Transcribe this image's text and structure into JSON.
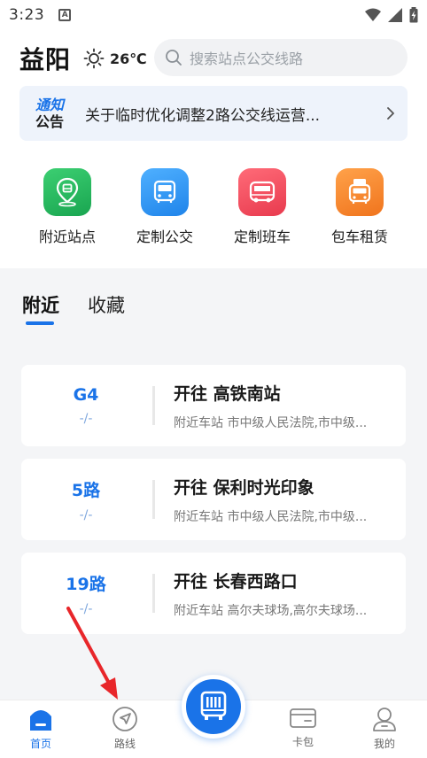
{
  "status_bar": {
    "time": "3:23",
    "notification_letter": "A"
  },
  "header": {
    "city": "益阳",
    "temperature": "26℃",
    "weather_icon": "sun-icon",
    "search_placeholder": "搜索站点公交线路"
  },
  "notice": {
    "badge_top": "通知",
    "badge_bottom": "公告",
    "text": "关于临时优化调整2路公交线运营..."
  },
  "services": [
    {
      "label": "附近站点",
      "icon": "location-pin-icon",
      "color": "#22b35b"
    },
    {
      "label": "定制公交",
      "icon": "bus-icon",
      "color": "#2f95f3"
    },
    {
      "label": "定制班车",
      "icon": "shuttle-bus-icon",
      "color": "#ef4b5d"
    },
    {
      "label": "包车租赁",
      "icon": "charter-bus-icon",
      "color": "#f5872d"
    }
  ],
  "tabs": [
    {
      "label": "附近",
      "active": true
    },
    {
      "label": "收藏",
      "active": false
    }
  ],
  "routes": [
    {
      "name": "G4",
      "eta": "-/-",
      "direction": "开往 高铁南站",
      "stations": "附近车站 市中级人民法院,市中级..."
    },
    {
      "name": "5路",
      "eta": "-/-",
      "direction": "开往 保利时光印象",
      "stations": "附近车站 市中级人民法院,市中级..."
    },
    {
      "name": "19路",
      "eta": "-/-",
      "direction": "开往 长春西路口",
      "stations": "附近车站 高尔夫球场,高尔夫球场..."
    }
  ],
  "bottom_nav": [
    {
      "label": "首页",
      "icon": "home-icon",
      "active": true
    },
    {
      "label": "路线",
      "icon": "navigation-arrow-icon",
      "active": false
    },
    {
      "label": "",
      "icon": "bus-qr-code-icon",
      "active": false
    },
    {
      "label": "卡包",
      "icon": "card-wallet-icon",
      "active": false
    },
    {
      "label": "我的",
      "icon": "user-profile-icon",
      "active": false
    }
  ],
  "colors": {
    "accent": "#1a73e8",
    "annotation_arrow": "#e8262a",
    "section_background": "#f4f5f7"
  }
}
